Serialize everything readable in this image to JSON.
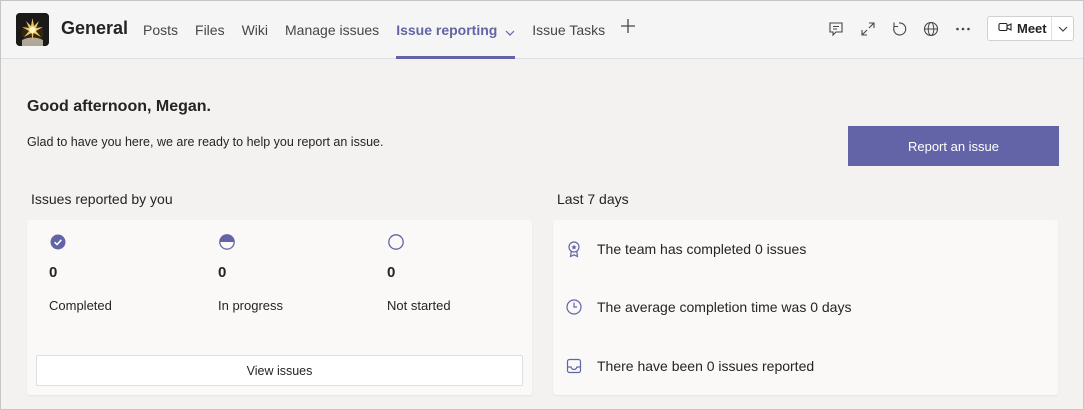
{
  "header": {
    "channel_title": "General",
    "tabs": [
      {
        "label": "Posts",
        "active": false
      },
      {
        "label": "Files",
        "active": false
      },
      {
        "label": "Wiki",
        "active": false
      },
      {
        "label": "Manage issues",
        "active": false
      },
      {
        "label": "Issue reporting",
        "active": true
      },
      {
        "label": "Issue Tasks",
        "active": false
      }
    ],
    "icons": [
      "conversation-icon",
      "expand-icon",
      "refresh-icon",
      "globe-icon",
      "more-options-icon"
    ],
    "meet_label": "Meet"
  },
  "main": {
    "greeting": "Good afternoon, Megan.",
    "subtext": "Glad to have you here, we are ready to help you report an issue.",
    "report_button_label": "Report an issue",
    "my_issues": {
      "title": "Issues reported by you",
      "stats": [
        {
          "value": "0",
          "label": "Completed",
          "icon": "completed-check-icon"
        },
        {
          "value": "0",
          "label": "In progress",
          "icon": "half-circle-icon"
        },
        {
          "value": "0",
          "label": "Not started",
          "icon": "empty-circle-icon"
        }
      ],
      "view_button_label": "View issues"
    },
    "last_week": {
      "title": "Last 7 days",
      "rows": [
        {
          "text": "The team has completed 0 issues",
          "icon": "award-ribbon-icon"
        },
        {
          "text": "The average completion time was 0 days",
          "icon": "clock-icon"
        },
        {
          "text": "There have been 0 issues reported",
          "icon": "inbox-tray-icon"
        }
      ]
    }
  },
  "colors": {
    "accent": "#6264a7",
    "background": "#f3f2f1",
    "card": "#faf9f8",
    "text": "#252423"
  }
}
